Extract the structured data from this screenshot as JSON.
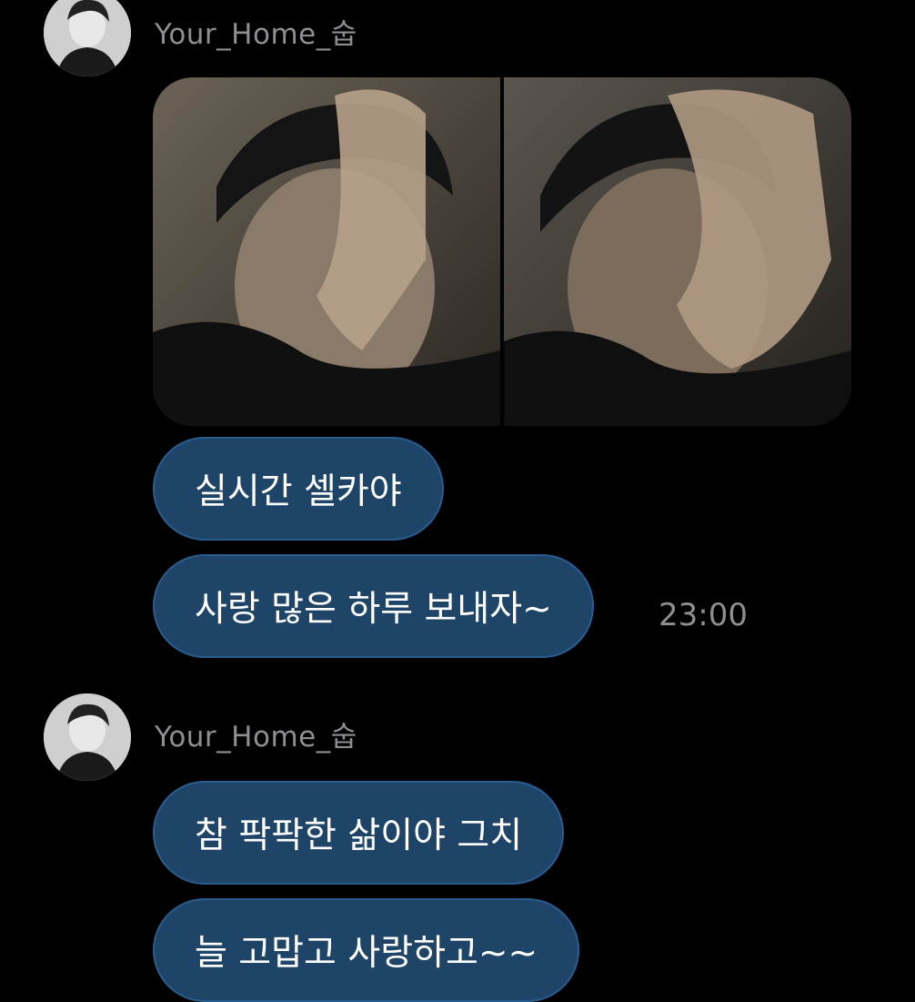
{
  "conversation": {
    "groups": [
      {
        "sender": "Your_Home_숩",
        "messages": [
          "실시간 셀카야",
          "사랑 많은 하루 보내자~"
        ],
        "timestamp": "23:00"
      },
      {
        "sender": "Your_Home_숩",
        "messages": [
          "참 팍팍한 삶이야 그치",
          "늘 고맙고 사랑하고~~"
        ]
      }
    ]
  },
  "colors": {
    "background": "#000000",
    "bubble": "#1e4468",
    "bubble_border": "#2a5d8f",
    "meta_text": "#8e8e93"
  }
}
